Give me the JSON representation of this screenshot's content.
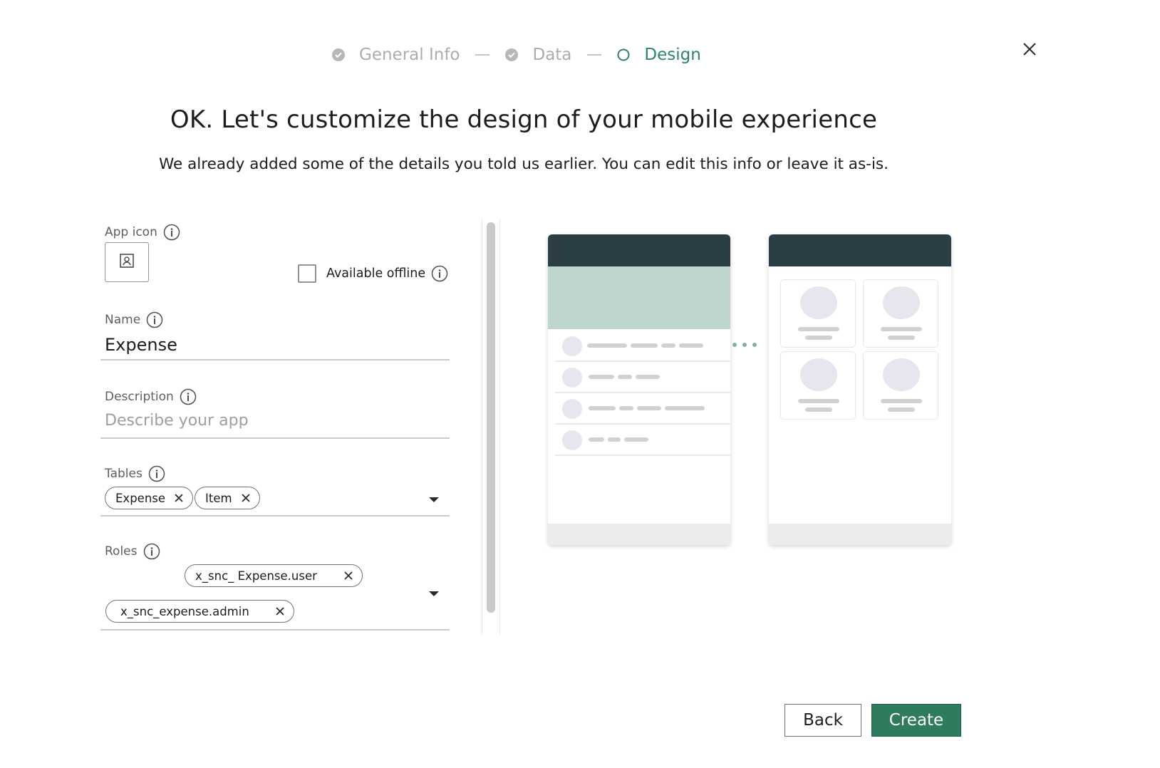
{
  "stepper": {
    "steps": [
      {
        "label": "General Info",
        "state": "done"
      },
      {
        "label": "Data",
        "state": "done"
      },
      {
        "label": "Design",
        "state": "active"
      }
    ]
  },
  "header": {
    "title": "OK. Let's customize the design of your mobile experience",
    "subtitle": "We already added some of the details you told us earlier. You can edit this info or leave it as-is."
  },
  "form": {
    "app_icon_label": "App icon",
    "available_offline_label": "Available offline",
    "name_label": "Name",
    "name_value": "Expense",
    "description_label": "Description",
    "description_placeholder": "Describe your app",
    "tables_label": "Tables",
    "tables": [
      "Expense",
      "Item"
    ],
    "roles_label": "Roles",
    "roles": [
      "x_snc_ Expense.user",
      "x_snc_expense.admin"
    ]
  },
  "actions": {
    "back_label": "Back",
    "create_label": "Create"
  },
  "colors": {
    "accent": "#2e7b5e",
    "phone_header": "#2c3e45",
    "banner": "#bfd6cc"
  }
}
